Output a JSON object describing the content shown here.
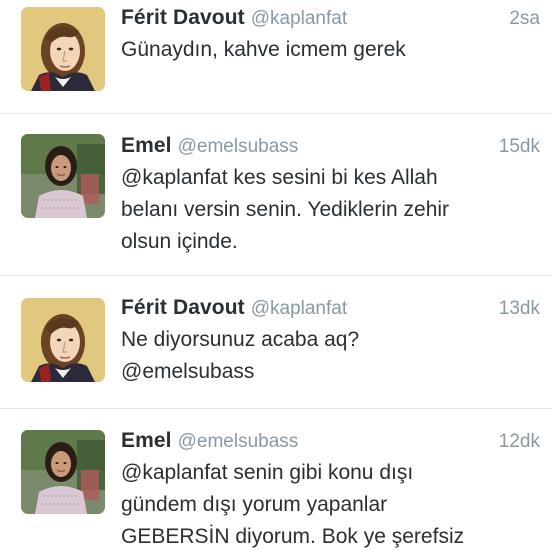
{
  "tweets": [
    {
      "name": "Férit Davout",
      "handle": "@kaplanfat",
      "time": "2sa",
      "text": "Günaydın, kahve icmem gerek",
      "avatar": "napoleon-portrait-avatar"
    },
    {
      "name": "Emel",
      "handle": "@emelsubass",
      "time": "15dk",
      "text": "@kaplanfat kes sesini bi kes Allah\nbelanı versin senin. Yediklerin zehir\nolsun içinde.",
      "avatar": "woman-photo-avatar"
    },
    {
      "name": "Férit Davout",
      "handle": "@kaplanfat",
      "time": "13dk",
      "text": "Ne diyorsunuz acaba aq?\n@emelsubass",
      "avatar": "napoleon-portrait-avatar"
    },
    {
      "name": "Emel",
      "handle": "@emelsubass",
      "time": "12dk",
      "text": "@kaplanfat senin gibi konu dışı\ngündem dışı yorum yapanlar\nGEBERSİN diyorum. Bok ye şerefsiz",
      "avatar": "woman-photo-avatar"
    }
  ],
  "colors": {
    "text": "#292f33",
    "muted": "#8899a6",
    "divider": "#e1e8ed"
  }
}
